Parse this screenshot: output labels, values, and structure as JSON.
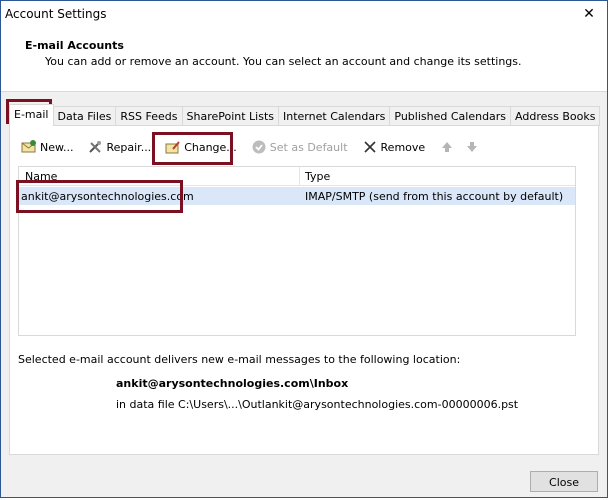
{
  "window": {
    "title": "Account Settings"
  },
  "header": {
    "title": "E-mail Accounts",
    "description": "You can add or remove an account. You can select an account and change its settings."
  },
  "tabs": [
    "E-mail",
    "Data Files",
    "RSS Feeds",
    "SharePoint Lists",
    "Internet Calendars",
    "Published Calendars",
    "Address Books"
  ],
  "toolbar": {
    "new_label": "New...",
    "repair_label": "Repair...",
    "change_label": "Change...",
    "set_default_label": "Set as Default",
    "remove_label": "Remove"
  },
  "accounts_table": {
    "columns": [
      "Name",
      "Type"
    ],
    "rows": [
      {
        "name": "ankit@arysontechnologies.com",
        "type": "IMAP/SMTP (send from this account by default)"
      }
    ]
  },
  "delivery": {
    "intro": "Selected e-mail account delivers new e-mail messages to the following location:",
    "folder": "ankit@arysontechnologies.com\\Inbox",
    "datafile": "in data file C:\\Users\\...\\Outlankit@arysontechnologies.com-00000006.pst"
  },
  "footer": {
    "close_label": "Close"
  },
  "colors": {
    "highlight": "#7a1022",
    "selection": "#d9e7f9"
  }
}
